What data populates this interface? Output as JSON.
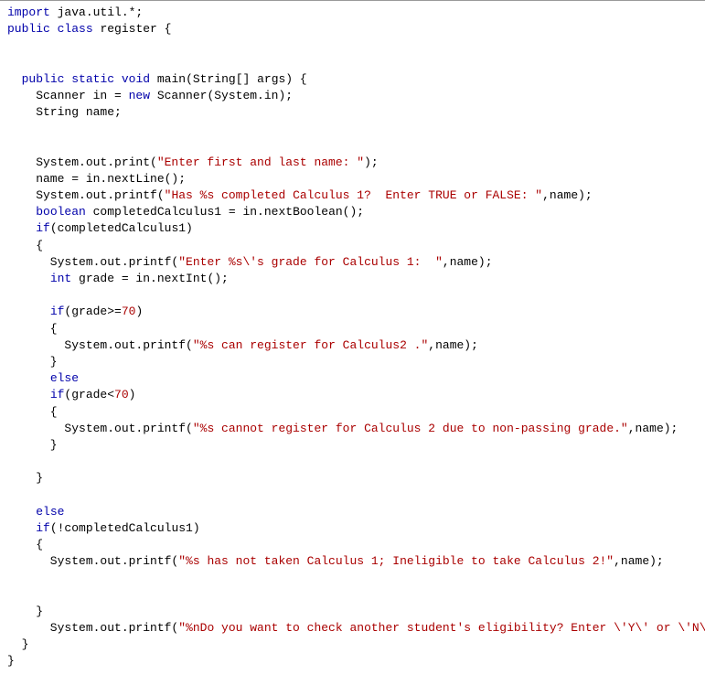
{
  "code": {
    "l01a": "import",
    "l01b": " java.util.*;",
    "l02a": "public",
    "l02b": " ",
    "l02c": "class",
    "l02d": " register {",
    "l03": "",
    "l04": "",
    "l05a": "  ",
    "l05b": "public",
    "l05c": " ",
    "l05d": "static",
    "l05e": " ",
    "l05f": "void",
    "l05g": " main(String[] args) {",
    "l06a": "    Scanner in = ",
    "l06b": "new",
    "l06c": " Scanner(System.in);",
    "l07": "    String name;",
    "l08": "",
    "l09": "",
    "l10a": "    System.out.print(",
    "l10b": "\"Enter first and last name: \"",
    "l10c": ");",
    "l11": "    name = in.nextLine();",
    "l12a": "    System.out.printf(",
    "l12b": "\"Has %s completed Calculus 1?  Enter TRUE or FALSE: \"",
    "l12c": ",name);",
    "l13a": "    ",
    "l13b": "boolean",
    "l13c": " completedCalculus1 = in.nextBoolean();",
    "l14a": "    ",
    "l14b": "if",
    "l14c": "(completedCalculus1)",
    "l15": "    {",
    "l16a": "      System.out.printf(",
    "l16b": "\"Enter %s\\'s grade for Calculus 1:  \"",
    "l16c": ",name);",
    "l17a": "      ",
    "l17b": "int",
    "l17c": " grade = in.nextInt();",
    "l18": "",
    "l19a": "      ",
    "l19b": "if",
    "l19c": "(grade>=",
    "l19d": "70",
    "l19e": ")",
    "l20": "      {",
    "l21a": "        System.out.printf(",
    "l21b": "\"%s can register for Calculus2 .\"",
    "l21c": ",name);",
    "l22": "      }",
    "l23a": "      ",
    "l23b": "else",
    "l24a": "      ",
    "l24b": "if",
    "l24c": "(grade<",
    "l24d": "70",
    "l24e": ")",
    "l25": "      {",
    "l26a": "        System.out.printf(",
    "l26b": "\"%s cannot register for Calculus 2 due to non-passing grade.\"",
    "l26c": ",name);",
    "l27": "      }",
    "l28": "",
    "l29": "    }",
    "l30": "",
    "l31a": "    ",
    "l31b": "else",
    "l32a": "    ",
    "l32b": "if",
    "l32c": "(!completedCalculus1)",
    "l33": "    {",
    "l34a": "      System.out.printf(",
    "l34b": "\"%s has not taken Calculus 1; Ineligible to take Calculus 2!\"",
    "l34c": ",name);",
    "l35": "",
    "l36": "",
    "l37": "    }",
    "l38a": "      System.out.printf(",
    "l38b": "\"%nDo you want to check another student's eligibility? Enter \\'Y\\' or \\'N\\': \"",
    "l38c": ");",
    "l39": "  }",
    "l40": "}"
  }
}
